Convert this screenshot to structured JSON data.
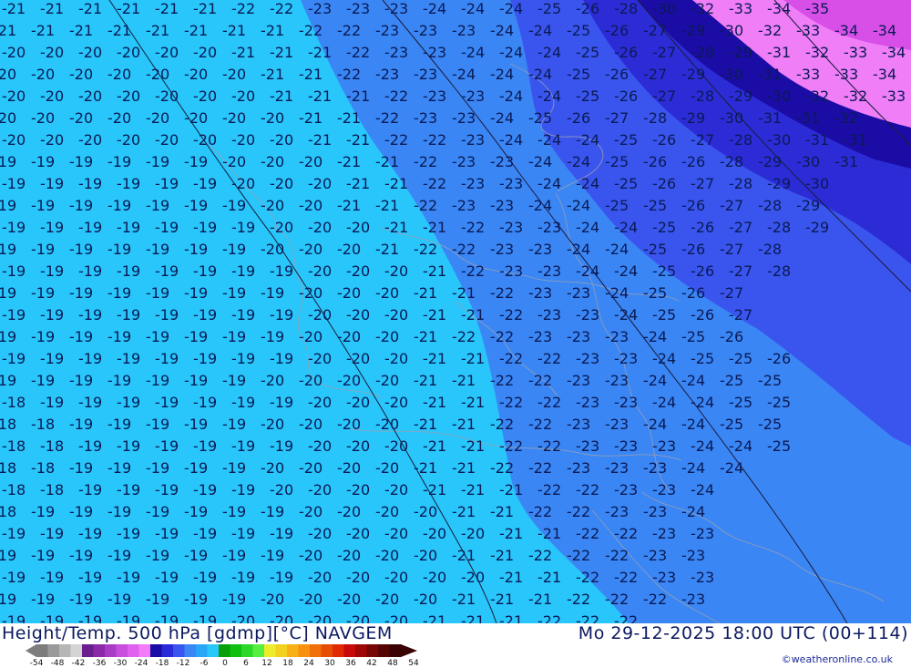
{
  "footer": {
    "title": "Height/Temp. 500 hPa [gdmp][°C] NAVGEM",
    "datetime": "Mo 29-12-2025 18:00 UTC (00+114)",
    "credit": "©weatheronline.co.uk"
  },
  "legend": {
    "ticks": [
      "-54",
      "-48",
      "-42",
      "-36",
      "-30",
      "-24",
      "-18",
      "-12",
      "-6",
      "0",
      "6",
      "12",
      "18",
      "24",
      "30",
      "36",
      "42",
      "48",
      "54"
    ],
    "colors": [
      "#7d7d7d",
      "#9a9a9a",
      "#b6b6b6",
      "#d4d4d4",
      "#6a1d8e",
      "#8a2aa8",
      "#a83cc4",
      "#c84fde",
      "#e060ef",
      "#f37cf8",
      "#1a0aa6",
      "#2a2ad8",
      "#3a55f0",
      "#3a86f5",
      "#2aa6f7",
      "#28c8fb",
      "#08a008",
      "#10c010",
      "#2ad82a",
      "#56ef40",
      "#ecec2a",
      "#f4d020",
      "#f8b016",
      "#f89010",
      "#f27008",
      "#e64e04",
      "#e02a02",
      "#c80a0a",
      "#a00808",
      "#780606",
      "#560404",
      "#3a0202"
    ]
  },
  "map": {
    "fill_colors": {
      "le_minus_30": "#1c0ca6",
      "minus_27_to_30": "#2c2cd6",
      "minus_24_to_27": "#3a55ee",
      "minus_21_to_24": "#3a86f4",
      "minus_18_to_21": "#28c6fa",
      "magenta_band": "#f07ef7",
      "magenta_deep": "#d84fe8"
    },
    "label_rows": [
      [
        "21",
        "21",
        "21",
        "21",
        "21",
        "21",
        "22",
        "22",
        "23",
        "23",
        "23",
        "24",
        "24",
        "24",
        "25",
        "26",
        "28",
        "30",
        "32",
        "33",
        "34",
        "35"
      ],
      [
        "21",
        "21",
        "21",
        "21",
        "21",
        "21",
        "21",
        "21",
        "22",
        "22",
        "23",
        "23",
        "23",
        "24",
        "24",
        "25",
        "26",
        "27",
        "29",
        "30",
        "32",
        "33",
        "34",
        "34"
      ],
      [
        "20",
        "20",
        "20",
        "20",
        "20",
        "20",
        "21",
        "21",
        "21",
        "22",
        "23",
        "23",
        "24",
        "24",
        "24",
        "25",
        "26",
        "27",
        "28",
        "29",
        "31",
        "32",
        "33",
        "34"
      ],
      [
        "20",
        "20",
        "20",
        "20",
        "20",
        "20",
        "20",
        "21",
        "21",
        "22",
        "23",
        "23",
        "24",
        "24",
        "24",
        "25",
        "26",
        "27",
        "29",
        "30",
        "31",
        "33",
        "33",
        "34"
      ],
      [
        "20",
        "20",
        "20",
        "20",
        "20",
        "20",
        "20",
        "21",
        "21",
        "21",
        "22",
        "23",
        "23",
        "24",
        "24",
        "25",
        "26",
        "27",
        "28",
        "29",
        "30",
        "32",
        "32",
        "33"
      ],
      [
        "20",
        "20",
        "20",
        "20",
        "20",
        "20",
        "20",
        "20",
        "21",
        "21",
        "22",
        "23",
        "23",
        "24",
        "25",
        "26",
        "27",
        "28",
        "29",
        "30",
        "31",
        "31",
        "32"
      ],
      [
        "20",
        "20",
        "20",
        "20",
        "20",
        "20",
        "20",
        "20",
        "21",
        "21",
        "22",
        "22",
        "23",
        "24",
        "24",
        "24",
        "25",
        "26",
        "27",
        "28",
        "30",
        "31",
        "31"
      ],
      [
        "19",
        "19",
        "19",
        "19",
        "19",
        "19",
        "20",
        "20",
        "20",
        "21",
        "21",
        "22",
        "23",
        "23",
        "24",
        "24",
        "25",
        "26",
        "26",
        "28",
        "29",
        "30",
        "31"
      ],
      [
        "19",
        "19",
        "19",
        "19",
        "19",
        "19",
        "20",
        "20",
        "20",
        "21",
        "21",
        "22",
        "23",
        "23",
        "24",
        "24",
        "25",
        "26",
        "27",
        "28",
        "29",
        "30"
      ],
      [
        "19",
        "19",
        "19",
        "19",
        "19",
        "19",
        "19",
        "20",
        "20",
        "21",
        "21",
        "22",
        "23",
        "23",
        "24",
        "24",
        "25",
        "25",
        "26",
        "27",
        "28",
        "29"
      ],
      [
        "19",
        "19",
        "19",
        "19",
        "19",
        "19",
        "19",
        "20",
        "20",
        "20",
        "21",
        "21",
        "22",
        "23",
        "23",
        "24",
        "24",
        "25",
        "26",
        "27",
        "28",
        "29"
      ],
      [
        "19",
        "19",
        "19",
        "19",
        "19",
        "19",
        "19",
        "20",
        "20",
        "20",
        "21",
        "22",
        "22",
        "23",
        "23",
        "24",
        "24",
        "25",
        "26",
        "27",
        "28"
      ],
      [
        "19",
        "19",
        "19",
        "19",
        "19",
        "19",
        "19",
        "19",
        "20",
        "20",
        "20",
        "21",
        "22",
        "23",
        "23",
        "24",
        "24",
        "25",
        "26",
        "27",
        "28"
      ],
      [
        "19",
        "19",
        "19",
        "19",
        "19",
        "19",
        "19",
        "19",
        "20",
        "20",
        "20",
        "21",
        "21",
        "22",
        "23",
        "23",
        "24",
        "25",
        "26",
        "27"
      ],
      [
        "19",
        "19",
        "19",
        "19",
        "19",
        "19",
        "19",
        "19",
        "20",
        "20",
        "20",
        "21",
        "21",
        "22",
        "23",
        "23",
        "24",
        "25",
        "26",
        "27"
      ],
      [
        "19",
        "19",
        "19",
        "19",
        "19",
        "19",
        "19",
        "19",
        "20",
        "20",
        "20",
        "21",
        "22",
        "22",
        "23",
        "23",
        "23",
        "24",
        "25",
        "26"
      ],
      [
        "19",
        "19",
        "19",
        "19",
        "19",
        "19",
        "19",
        "19",
        "20",
        "20",
        "20",
        "21",
        "21",
        "22",
        "22",
        "23",
        "23",
        "24",
        "25",
        "25",
        "26"
      ],
      [
        "19",
        "19",
        "19",
        "19",
        "19",
        "19",
        "19",
        "20",
        "20",
        "20",
        "20",
        "21",
        "21",
        "22",
        "22",
        "23",
        "23",
        "24",
        "24",
        "25",
        "25"
      ],
      [
        "18",
        "19",
        "19",
        "19",
        "19",
        "19",
        "19",
        "19",
        "20",
        "20",
        "20",
        "21",
        "21",
        "22",
        "22",
        "23",
        "23",
        "24",
        "24",
        "25",
        "25"
      ],
      [
        "18",
        "18",
        "19",
        "19",
        "19",
        "19",
        "19",
        "20",
        "20",
        "20",
        "20",
        "21",
        "21",
        "22",
        "22",
        "23",
        "23",
        "24",
        "24",
        "25",
        "25"
      ],
      [
        "18",
        "18",
        "19",
        "19",
        "19",
        "19",
        "19",
        "19",
        "20",
        "20",
        "20",
        "21",
        "21",
        "22",
        "22",
        "23",
        "23",
        "23",
        "24",
        "24",
        "25"
      ],
      [
        "18",
        "18",
        "19",
        "19",
        "19",
        "19",
        "19",
        "20",
        "20",
        "20",
        "20",
        "21",
        "21",
        "22",
        "22",
        "23",
        "23",
        "23",
        "24",
        "24"
      ],
      [
        "18",
        "18",
        "19",
        "19",
        "19",
        "19",
        "19",
        "20",
        "20",
        "20",
        "20",
        "21",
        "21",
        "21",
        "22",
        "22",
        "23",
        "23",
        "24"
      ],
      [
        "18",
        "19",
        "19",
        "19",
        "19",
        "19",
        "19",
        "19",
        "20",
        "20",
        "20",
        "20",
        "21",
        "21",
        "22",
        "22",
        "23",
        "23",
        "24"
      ],
      [
        "19",
        "19",
        "19",
        "19",
        "19",
        "19",
        "19",
        "19",
        "20",
        "20",
        "20",
        "20",
        "20",
        "21",
        "21",
        "22",
        "22",
        "23",
        "23"
      ],
      [
        "19",
        "19",
        "19",
        "19",
        "19",
        "19",
        "19",
        "19",
        "20",
        "20",
        "20",
        "20",
        "21",
        "21",
        "22",
        "22",
        "22",
        "23",
        "23"
      ],
      [
        "19",
        "19",
        "19",
        "19",
        "19",
        "19",
        "19",
        "19",
        "20",
        "20",
        "20",
        "20",
        "20",
        "21",
        "21",
        "22",
        "22",
        "23",
        "23"
      ],
      [
        "19",
        "19",
        "19",
        "19",
        "19",
        "19",
        "19",
        "20",
        "20",
        "20",
        "20",
        "20",
        "21",
        "21",
        "21",
        "22",
        "22",
        "22",
        "23"
      ],
      [
        "19",
        "19",
        "19",
        "19",
        "19",
        "19",
        "20",
        "20",
        "20",
        "20",
        "20",
        "21",
        "21",
        "21",
        "22",
        "22",
        "22"
      ]
    ]
  }
}
